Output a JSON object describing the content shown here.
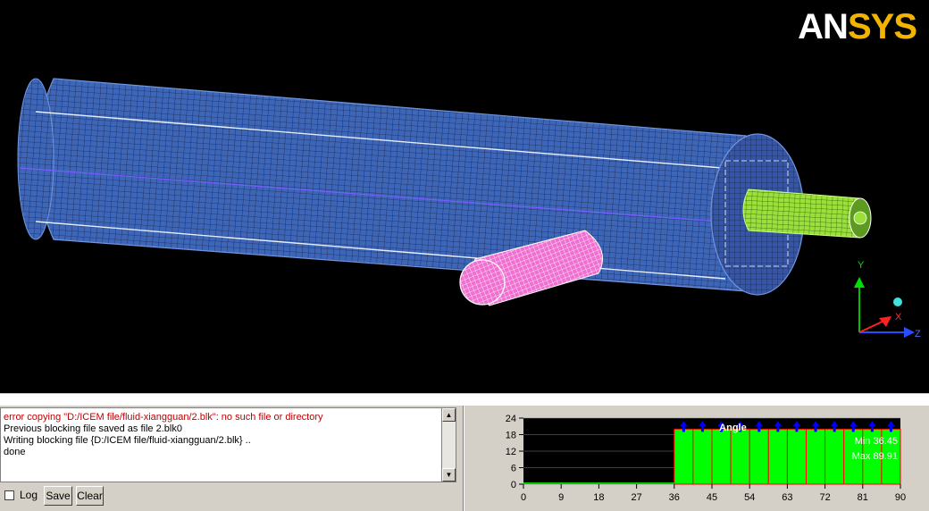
{
  "viewport": {
    "logo": {
      "part1": "AN",
      "part2": "SYS",
      "colors": {
        "an": "#ffffff",
        "sys": "#f2b400"
      }
    },
    "background": "#000000",
    "model_colors": {
      "main_cylinder": "#3d66b8",
      "mesh_lines": "#1a2a55",
      "outlet_pipe": "#9be03a",
      "inlet_pipe": "#f06fd0"
    },
    "axes": {
      "y": "Y",
      "x": "X",
      "z": "Z"
    }
  },
  "messages": {
    "lines": [
      {
        "text": "error copying \"D:/ICEM file/fluid-xiangguan/2.blk\": no such file or directory",
        "type": "error"
      },
      {
        "text": "Previous blocking file saved as file 2.blk0",
        "type": "info"
      },
      {
        "text": "Writing blocking file {D:/ICEM file/fluid-xiangguan/2.blk} ..",
        "type": "info"
      },
      {
        "text": "done",
        "type": "info"
      }
    ],
    "log_label": "Log",
    "log_checked": false,
    "save_label": "Save",
    "clear_label": "Clear",
    "scroll_up_icon": "arrow-up-icon",
    "scroll_down_icon": "arrow-down-icon"
  },
  "chart_data": {
    "type": "bar",
    "title": "Angle",
    "x_ticks": [
      "0",
      "9",
      "18",
      "27",
      "36",
      "45",
      "54",
      "63",
      "72",
      "81",
      "90"
    ],
    "y_ticks": [
      "0",
      "6",
      "12",
      "18",
      "24"
    ],
    "xlim": [
      0,
      90
    ],
    "ylim": [
      0,
      24
    ],
    "bins": [
      {
        "x0": 36,
        "x1": 40.5,
        "value": 20
      },
      {
        "x0": 40.5,
        "x1": 45,
        "value": 20
      },
      {
        "x0": 45,
        "x1": 49.5,
        "value": 20
      },
      {
        "x0": 49.5,
        "x1": 54,
        "value": 20
      },
      {
        "x0": 54,
        "x1": 58.5,
        "value": 20
      },
      {
        "x0": 58.5,
        "x1": 63,
        "value": 20
      },
      {
        "x0": 63,
        "x1": 67.5,
        "value": 20
      },
      {
        "x0": 67.5,
        "x1": 72,
        "value": 20
      },
      {
        "x0": 72,
        "x1": 76.5,
        "value": 20
      },
      {
        "x0": 76.5,
        "x1": 81,
        "value": 20
      },
      {
        "x0": 81,
        "x1": 85.5,
        "value": 20
      },
      {
        "x0": 85.5,
        "x1": 90,
        "value": 20
      }
    ],
    "markers_x": [
      38.25,
      42.75,
      47.25,
      51.75,
      56.25,
      60.75,
      65.25,
      69.75,
      74.25,
      78.75,
      83.25,
      87.75
    ],
    "min_label": "Min 36.45",
    "max_label": "Max 89.91",
    "grid": true,
    "colors": {
      "bar": "#00ff00",
      "bar_edge": "#ff0000",
      "marker": "#0000ff",
      "background": "#000000",
      "grid": "#808080",
      "baseline": "#00cc00"
    }
  }
}
